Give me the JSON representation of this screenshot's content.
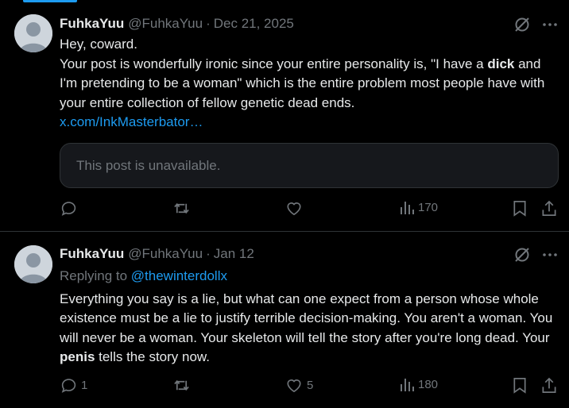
{
  "tweets": [
    {
      "name": "FuhkaYuu",
      "handle": "@FuhkaYuu",
      "separator": "·",
      "date": "Dec 21, 2025",
      "line1": "Hey, coward.",
      "text_a": "Your post is wonderfully ironic since your entire personality is, \"I have a ",
      "bold_a": "dick",
      "text_b": " and I'm pretending to be a woman\" which is the entire problem most people have with your entire collection of fellow genetic dead ends.",
      "link": "x.com/InkMasterbator…",
      "quote_unavailable": "This post is unavailable.",
      "actions": {
        "replies": "",
        "reposts": "",
        "likes": "",
        "views": "170"
      }
    },
    {
      "name": "FuhkaYuu",
      "handle": "@FuhkaYuu",
      "separator": "·",
      "date": "Jan 12",
      "replying_prefix": "Replying to ",
      "replying_to": "@thewinterdollx",
      "text_a": "Everything you say is a lie, but what can one expect from a person whose whole existence must be a lie to justify terrible decision-making. You aren't a woman. You will never be a woman. Your skeleton will tell the story after you're long dead. Your ",
      "bold_a": "penis",
      "text_b": " tells the story now.",
      "actions": {
        "replies": "1",
        "reposts": "",
        "likes": "5",
        "views": "180"
      }
    }
  ],
  "colors": {
    "accent": "#1d9bf0",
    "muted": "#71767b",
    "text": "#e7e9ea",
    "background": "#000000"
  },
  "icons": [
    "grok-icon",
    "more-icon",
    "reply-icon",
    "repost-icon",
    "like-icon",
    "views-icon",
    "bookmark-icon",
    "share-icon"
  ]
}
